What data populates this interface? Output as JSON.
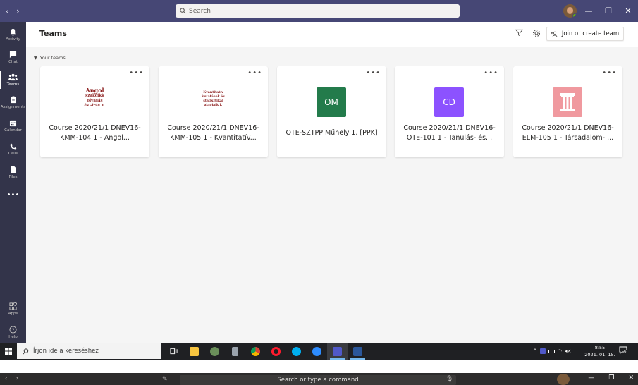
{
  "titlebar": {
    "search_placeholder": "Search",
    "minimize": "—",
    "restore": "❐",
    "close": "✕",
    "back": "‹",
    "forward": "›"
  },
  "rail": {
    "items": [
      {
        "label": "Activity",
        "icon": "bell-icon"
      },
      {
        "label": "Chat",
        "icon": "chat-icon"
      },
      {
        "label": "Teams",
        "icon": "teams-icon"
      },
      {
        "label": "Assignments",
        "icon": "assignments-icon"
      },
      {
        "label": "Calendar",
        "icon": "calendar-icon"
      },
      {
        "label": "Calls",
        "icon": "phone-icon"
      },
      {
        "label": "Files",
        "icon": "file-icon"
      }
    ],
    "more": "•••",
    "apps_label": "Apps",
    "help_label": "Help"
  },
  "header": {
    "title": "Teams",
    "join_button": "Join or create team"
  },
  "section": {
    "label": "Your teams",
    "caret": "▼"
  },
  "teams": [
    {
      "name": "Course 2020/21/1 DNEV16-KMM-104 1 - Angol...",
      "image_lines": [
        "Angol",
        "szakcikk",
        "olvasás",
        "és -írás 1."
      ]
    },
    {
      "name": "Course 2020/21/1 DNEV16-KMM-105 1 - Kvantitatív...",
      "image_lines": [
        "Kvantitatív",
        "kutatások és",
        "statisztikai",
        "alapjaik I."
      ]
    },
    {
      "name": "OTE-SZTPP Műhely 1. [PPK]",
      "initials": "OM",
      "color": "#237b4b"
    },
    {
      "name": "Course 2020/21/1 DNEV16-OTE-101 1 - Tanulás- és...",
      "initials": "CD",
      "color": "#8c52ff"
    },
    {
      "name": "Course 2020/21/1 DNEV16-ELM-105 1 - Társadalom- ...",
      "image": "pillar-icon",
      "color": "#f0999f"
    }
  ],
  "card_more": "•••",
  "taskbar": {
    "search_placeholder": "Írjon ide a kereséshez",
    "time": "8:55",
    "date": "2021. 01. 15.",
    "notifications": "6"
  },
  "lower_window": {
    "search_placeholder": "Search or type a command"
  }
}
